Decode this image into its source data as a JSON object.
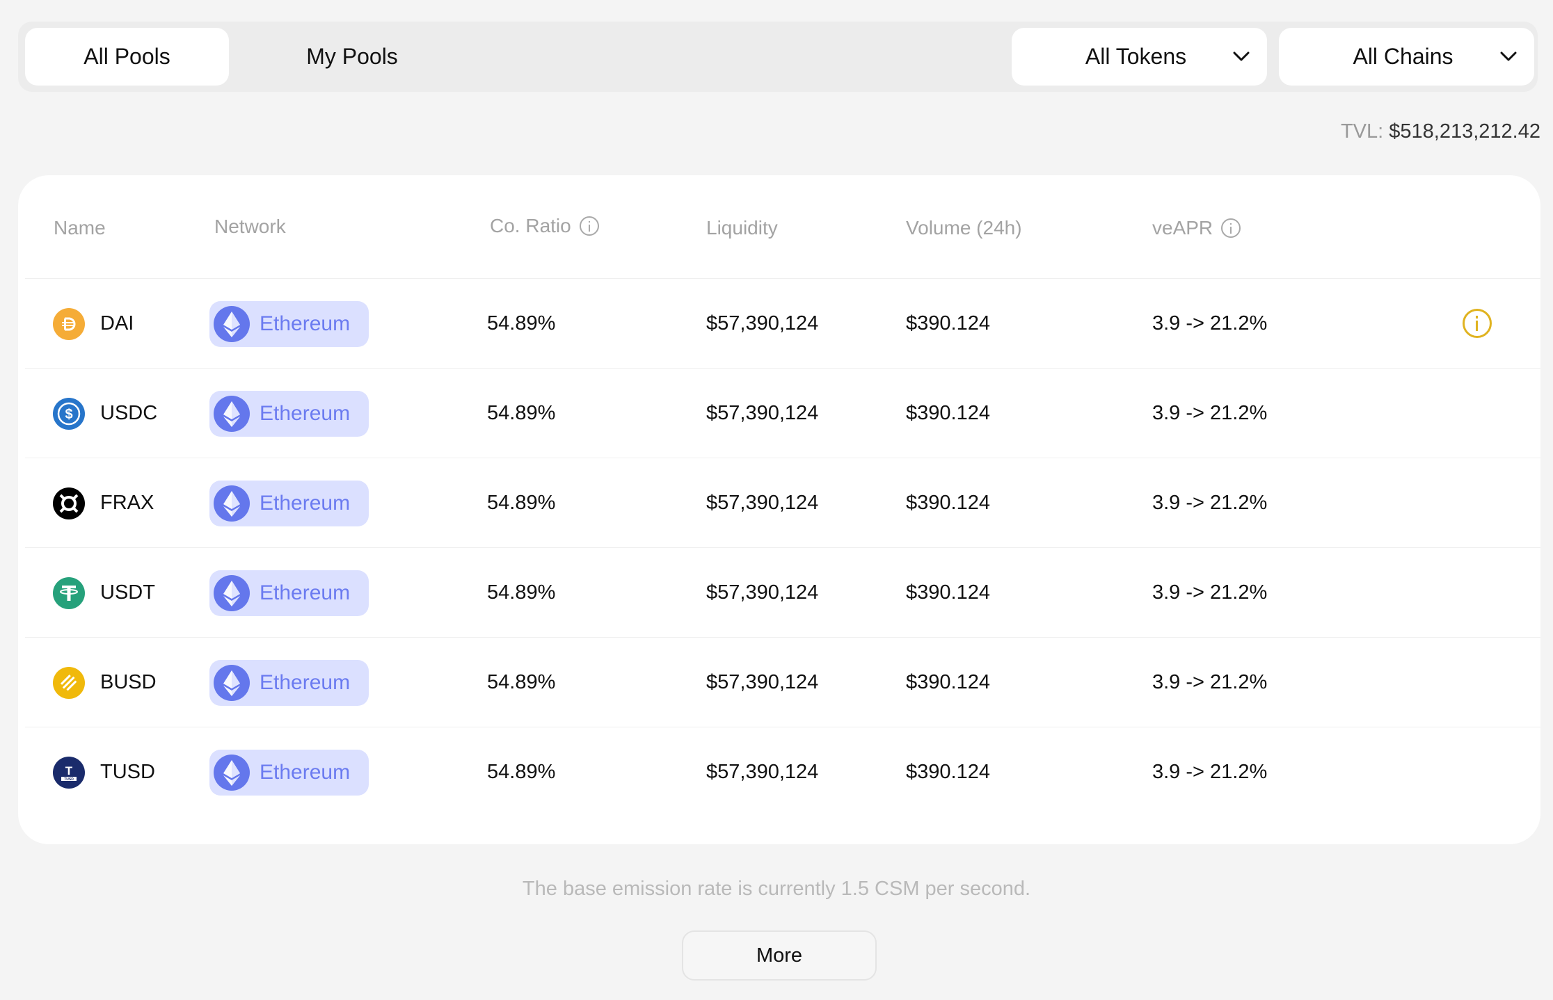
{
  "tabs": [
    {
      "label": "All Pools",
      "active": true
    },
    {
      "label": "My Pools",
      "active": false
    }
  ],
  "filters": {
    "tokens_label": "All Tokens",
    "chains_label": "All Chains"
  },
  "tvl": {
    "label": "TVL:",
    "value": "$518,213,212.42"
  },
  "table": {
    "headers": {
      "name": "Name",
      "network": "Network",
      "ratio": "Co. Ratio",
      "liquidity": "Liquidity",
      "volume": "Volume (24h)",
      "apr": "veAPR"
    },
    "rows": [
      {
        "name": "DAI",
        "icon": "dai-icon",
        "color": "#f5ac37",
        "network": "Ethereum",
        "ratio": "54.89%",
        "liquidity": "$57,390,124",
        "volume": "$390.124",
        "apr": "3.9 -> 21.2%",
        "has_info": true
      },
      {
        "name": "USDC",
        "icon": "usdc-icon",
        "color": "#2775ca",
        "network": "Ethereum",
        "ratio": "54.89%",
        "liquidity": "$57,390,124",
        "volume": "$390.124",
        "apr": "3.9 -> 21.2%",
        "has_info": false
      },
      {
        "name": "FRAX",
        "icon": "frax-icon",
        "color": "#000000",
        "network": "Ethereum",
        "ratio": "54.89%",
        "liquidity": "$57,390,124",
        "volume": "$390.124",
        "apr": "3.9 -> 21.2%",
        "has_info": false
      },
      {
        "name": "USDT",
        "icon": "usdt-icon",
        "color": "#26a17b",
        "network": "Ethereum",
        "ratio": "54.89%",
        "liquidity": "$57,390,124",
        "volume": "$390.124",
        "apr": "3.9 -> 21.2%",
        "has_info": false
      },
      {
        "name": "BUSD",
        "icon": "busd-icon",
        "color": "#f0b90b",
        "network": "Ethereum",
        "ratio": "54.89%",
        "liquidity": "$57,390,124",
        "volume": "$390.124",
        "apr": "3.9 -> 21.2%",
        "has_info": false
      },
      {
        "name": "TUSD",
        "icon": "tusd-icon",
        "color": "#1a2b6b",
        "network": "Ethereum",
        "ratio": "54.89%",
        "liquidity": "$57,390,124",
        "volume": "$390.124",
        "apr": "3.9 -> 21.2%",
        "has_info": false
      }
    ]
  },
  "footnote": "The base emission rate is currently 1.5 CSM per second.",
  "more_label": "More",
  "colors": {
    "accent": "#6b7bf0",
    "chip_bg": "#dbe0ff",
    "info_yellow": "#e0b320"
  }
}
